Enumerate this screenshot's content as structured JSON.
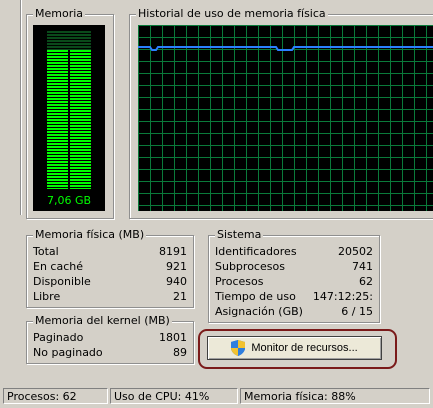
{
  "memory_gauge": {
    "title": "Memoria",
    "value_label": "7,06 GB",
    "fill_fraction": 0.88
  },
  "history": {
    "title": "Historial de uso de memoria física",
    "usage_fraction": 0.88
  },
  "physical_memory": {
    "title": "Memoria física (MB)",
    "rows": [
      {
        "label": "Total",
        "value": "8191"
      },
      {
        "label": "En caché",
        "value": "921"
      },
      {
        "label": "Disponible",
        "value": "940"
      },
      {
        "label": "Libre",
        "value": "21"
      }
    ]
  },
  "kernel_memory": {
    "title": "Memoria del kernel (MB)",
    "rows": [
      {
        "label": "Paginado",
        "value": "1801"
      },
      {
        "label": "No paginado",
        "value": "89"
      }
    ]
  },
  "system": {
    "title": "Sistema",
    "rows": [
      {
        "label": "Identificadores",
        "value": "20502"
      },
      {
        "label": "Subprocesos",
        "value": "741"
      },
      {
        "label": "Procesos",
        "value": "62"
      },
      {
        "label": "Tiempo de uso",
        "value": "147:12:25:"
      },
      {
        "label": "Asignación (GB)",
        "value": "6 / 15"
      }
    ]
  },
  "resource_monitor_button": {
    "label": "Monitor de recursos...",
    "icon": "uac-shield-icon"
  },
  "status_bar": {
    "processes": "Procesos: 62",
    "cpu": "Uso de CPU: 41%",
    "memory": "Memoria física: 88%"
  },
  "colors": {
    "gauge_green": "#00ff00",
    "graph_line": "#2a7fff",
    "grid": "#0a7a3a",
    "highlight_ring": "#7a1a1a"
  }
}
